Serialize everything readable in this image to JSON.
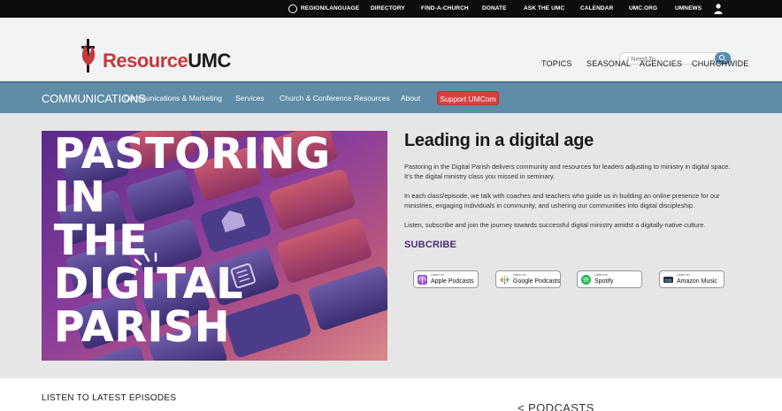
{
  "topbar": {
    "region": "REGION/LANGUAGE",
    "directory": "DIRECTORY",
    "find_church": "FIND-A-CHURCH",
    "donate": "DONATE",
    "ask": "ASK THE UMC",
    "calendar": "CALENDAR",
    "umcorg": "UMC.ORG",
    "umnews": "UMNEWS"
  },
  "logo": {
    "part1": "Resource",
    "part2": "UMC"
  },
  "search": {
    "placeholder": "I Need To..."
  },
  "mainnav": {
    "topics": "TOPICS",
    "seasonal": "SEASONAL",
    "agencies": "AGENCIES",
    "churchwide": "CHURCHWIDE"
  },
  "subnav": {
    "title": "COMMUNICATIONS",
    "items": [
      "Communications & Marketing",
      "Services",
      "Church & Conference Resources",
      "About"
    ],
    "cta": "Support UMCom"
  },
  "hero": {
    "lines": [
      "PASTORING",
      "IN",
      "THE",
      "DIGITAL",
      "PARISH"
    ]
  },
  "content": {
    "heading": "Leading in a digital age",
    "p1": "Pastoring in the Digital Parish delivers community and resources for leaders adjusting to ministry in digital space. It's the digital ministry class you missed in seminary.",
    "p2": "In each class/episode, we talk with coaches and teachers who guide us in building an online presence for our ministries, engaging individuals in community, and ushering our communities into digital discipleship.",
    "p3": "Listen, subscribe and join the journey towards successful digital ministry amidst a digitally-native culture.",
    "subscribe": "SUBCRIBE"
  },
  "podcasts": [
    {
      "small": "Listen on",
      "name": "Apple Podcasts",
      "icon": "apple-podcasts-icon",
      "color": "#9b4fd4"
    },
    {
      "small": "Listen on",
      "name": "Google Podcasts",
      "icon": "google-podcasts-icon",
      "color": "#4285f4"
    },
    {
      "small": "Listen on",
      "name": "Spotify",
      "icon": "spotify-icon",
      "color": "#1db954"
    },
    {
      "small": "Listen on",
      "name": "Amazon Music",
      "icon": "amazon-music-icon",
      "color": "#232f3e"
    }
  ],
  "bottom": {
    "episodes": "LISTEN TO LATEST EPISODES",
    "podcasts": "< PODCASTS"
  },
  "colors": {
    "brand_red": "#c53a3a",
    "subnav_blue": "#5f8ca7",
    "cta_red": "#d8403f",
    "subscribe_purple": "#4a2c73"
  }
}
